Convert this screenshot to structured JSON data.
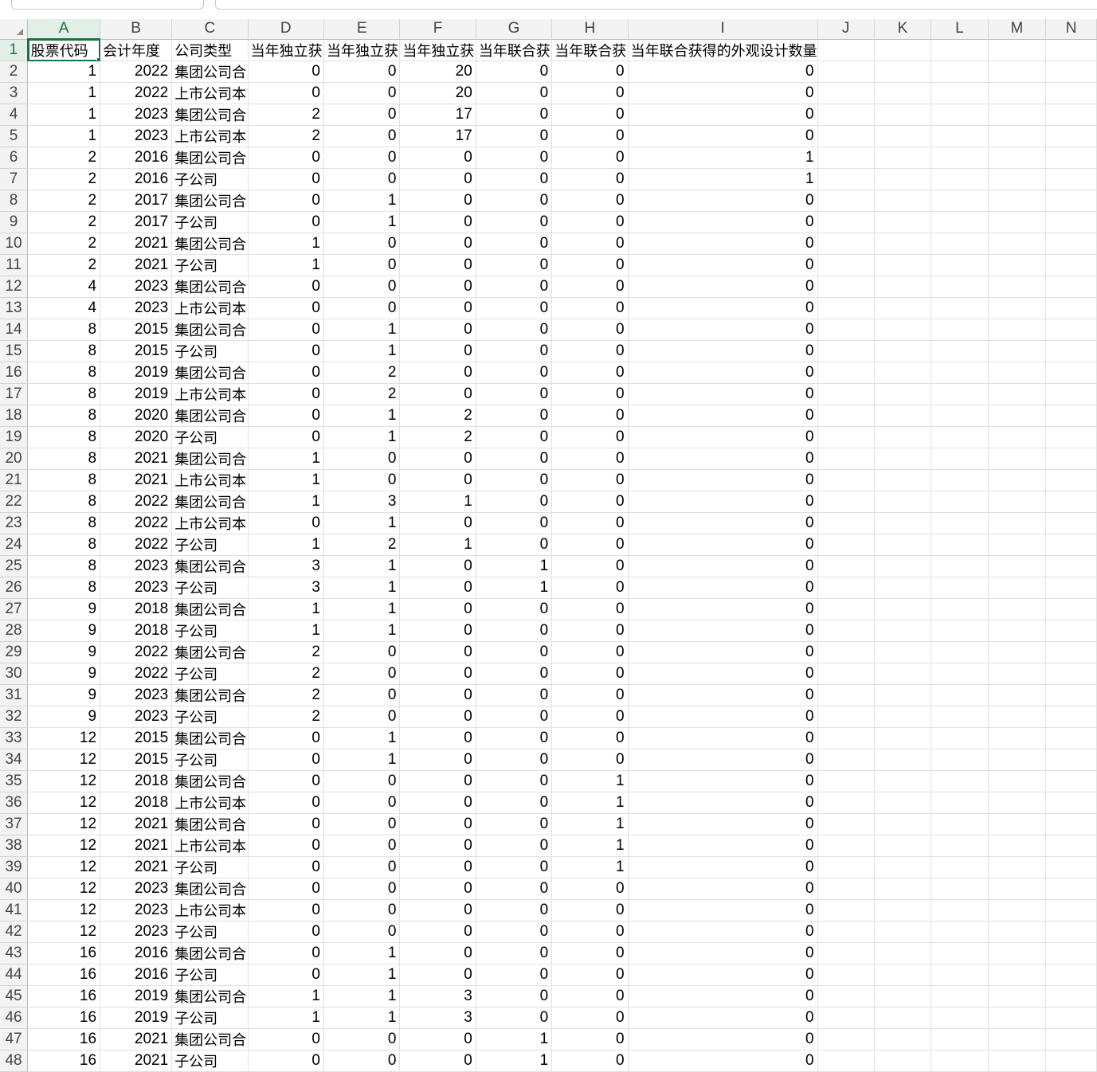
{
  "columns": [
    "A",
    "B",
    "C",
    "D",
    "E",
    "F",
    "G",
    "H",
    "I",
    "J",
    "K",
    "L",
    "M",
    "N"
  ],
  "header_row": [
    "股票代码",
    "会计年度",
    "公司类型",
    "当年独立获",
    "当年独立获",
    "当年独立获",
    "当年联合获",
    "当年联合获",
    "当年联合获得的外观设计数量"
  ],
  "rows": [
    [
      "1",
      "2022",
      "集团公司合",
      "0",
      "0",
      "20",
      "0",
      "0",
      "0"
    ],
    [
      "1",
      "2022",
      "上市公司本",
      "0",
      "0",
      "20",
      "0",
      "0",
      "0"
    ],
    [
      "1",
      "2023",
      "集团公司合",
      "2",
      "0",
      "17",
      "0",
      "0",
      "0"
    ],
    [
      "1",
      "2023",
      "上市公司本",
      "2",
      "0",
      "17",
      "0",
      "0",
      "0"
    ],
    [
      "2",
      "2016",
      "集团公司合",
      "0",
      "0",
      "0",
      "0",
      "0",
      "1"
    ],
    [
      "2",
      "2016",
      "子公司",
      "0",
      "0",
      "0",
      "0",
      "0",
      "1"
    ],
    [
      "2",
      "2017",
      "集团公司合",
      "0",
      "1",
      "0",
      "0",
      "0",
      "0"
    ],
    [
      "2",
      "2017",
      "子公司",
      "0",
      "1",
      "0",
      "0",
      "0",
      "0"
    ],
    [
      "2",
      "2021",
      "集团公司合",
      "1",
      "0",
      "0",
      "0",
      "0",
      "0"
    ],
    [
      "2",
      "2021",
      "子公司",
      "1",
      "0",
      "0",
      "0",
      "0",
      "0"
    ],
    [
      "4",
      "2023",
      "集团公司合",
      "0",
      "0",
      "0",
      "0",
      "0",
      "0"
    ],
    [
      "4",
      "2023",
      "上市公司本",
      "0",
      "0",
      "0",
      "0",
      "0",
      "0"
    ],
    [
      "8",
      "2015",
      "集团公司合",
      "0",
      "1",
      "0",
      "0",
      "0",
      "0"
    ],
    [
      "8",
      "2015",
      "子公司",
      "0",
      "1",
      "0",
      "0",
      "0",
      "0"
    ],
    [
      "8",
      "2019",
      "集团公司合",
      "0",
      "2",
      "0",
      "0",
      "0",
      "0"
    ],
    [
      "8",
      "2019",
      "上市公司本",
      "0",
      "2",
      "0",
      "0",
      "0",
      "0"
    ],
    [
      "8",
      "2020",
      "集团公司合",
      "0",
      "1",
      "2",
      "0",
      "0",
      "0"
    ],
    [
      "8",
      "2020",
      "子公司",
      "0",
      "1",
      "2",
      "0",
      "0",
      "0"
    ],
    [
      "8",
      "2021",
      "集团公司合",
      "1",
      "0",
      "0",
      "0",
      "0",
      "0"
    ],
    [
      "8",
      "2021",
      "上市公司本",
      "1",
      "0",
      "0",
      "0",
      "0",
      "0"
    ],
    [
      "8",
      "2022",
      "集团公司合",
      "1",
      "3",
      "1",
      "0",
      "0",
      "0"
    ],
    [
      "8",
      "2022",
      "上市公司本",
      "0",
      "1",
      "0",
      "0",
      "0",
      "0"
    ],
    [
      "8",
      "2022",
      "子公司",
      "1",
      "2",
      "1",
      "0",
      "0",
      "0"
    ],
    [
      "8",
      "2023",
      "集团公司合",
      "3",
      "1",
      "0",
      "1",
      "0",
      "0"
    ],
    [
      "8",
      "2023",
      "子公司",
      "3",
      "1",
      "0",
      "1",
      "0",
      "0"
    ],
    [
      "9",
      "2018",
      "集团公司合",
      "1",
      "1",
      "0",
      "0",
      "0",
      "0"
    ],
    [
      "9",
      "2018",
      "子公司",
      "1",
      "1",
      "0",
      "0",
      "0",
      "0"
    ],
    [
      "9",
      "2022",
      "集团公司合",
      "2",
      "0",
      "0",
      "0",
      "0",
      "0"
    ],
    [
      "9",
      "2022",
      "子公司",
      "2",
      "0",
      "0",
      "0",
      "0",
      "0"
    ],
    [
      "9",
      "2023",
      "集团公司合",
      "2",
      "0",
      "0",
      "0",
      "0",
      "0"
    ],
    [
      "9",
      "2023",
      "子公司",
      "2",
      "0",
      "0",
      "0",
      "0",
      "0"
    ],
    [
      "12",
      "2015",
      "集团公司合",
      "0",
      "1",
      "0",
      "0",
      "0",
      "0"
    ],
    [
      "12",
      "2015",
      "子公司",
      "0",
      "1",
      "0",
      "0",
      "0",
      "0"
    ],
    [
      "12",
      "2018",
      "集团公司合",
      "0",
      "0",
      "0",
      "0",
      "1",
      "0"
    ],
    [
      "12",
      "2018",
      "上市公司本",
      "0",
      "0",
      "0",
      "0",
      "1",
      "0"
    ],
    [
      "12",
      "2021",
      "集团公司合",
      "0",
      "0",
      "0",
      "0",
      "1",
      "0"
    ],
    [
      "12",
      "2021",
      "上市公司本",
      "0",
      "0",
      "0",
      "0",
      "1",
      "0"
    ],
    [
      "12",
      "2021",
      "子公司",
      "0",
      "0",
      "0",
      "0",
      "1",
      "0"
    ],
    [
      "12",
      "2023",
      "集团公司合",
      "0",
      "0",
      "0",
      "0",
      "0",
      "0"
    ],
    [
      "12",
      "2023",
      "上市公司本",
      "0",
      "0",
      "0",
      "0",
      "0",
      "0"
    ],
    [
      "12",
      "2023",
      "子公司",
      "0",
      "0",
      "0",
      "0",
      "0",
      "0"
    ],
    [
      "16",
      "2016",
      "集团公司合",
      "0",
      "1",
      "0",
      "0",
      "0",
      "0"
    ],
    [
      "16",
      "2016",
      "子公司",
      "0",
      "1",
      "0",
      "0",
      "0",
      "0"
    ],
    [
      "16",
      "2019",
      "集团公司合",
      "1",
      "1",
      "3",
      "0",
      "0",
      "0"
    ],
    [
      "16",
      "2019",
      "子公司",
      "1",
      "1",
      "3",
      "0",
      "0",
      "0"
    ],
    [
      "16",
      "2021",
      "集团公司合",
      "0",
      "0",
      "0",
      "1",
      "0",
      "0"
    ],
    [
      "16",
      "2021",
      "子公司",
      "0",
      "0",
      "0",
      "1",
      "0",
      "0"
    ]
  ],
  "colors": {
    "accent": "#1e7145",
    "header_bg": "#f3f3f3",
    "grid": "#e1e1e1"
  }
}
